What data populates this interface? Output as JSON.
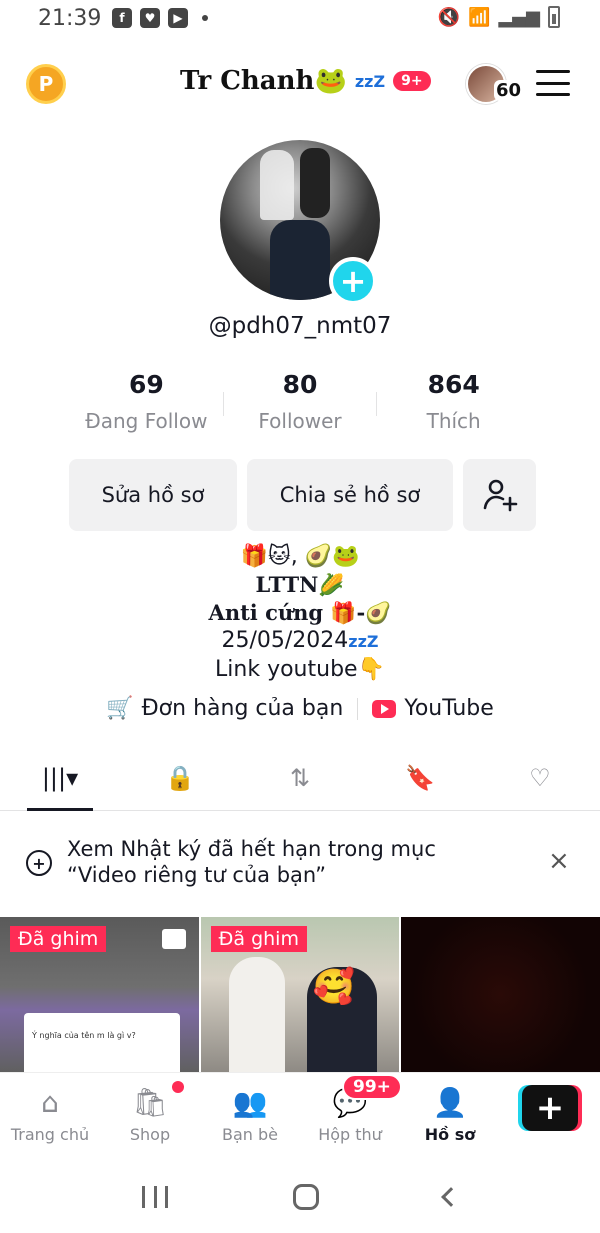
{
  "status_bar": {
    "time": "21:39",
    "left_icons": [
      "facebook-icon",
      "heart-app-icon",
      "video-app-icon"
    ],
    "right_icons": [
      "mute-icon",
      "wifi-icon",
      "signal-icon",
      "battery-icon"
    ]
  },
  "header": {
    "coin_label": "P",
    "title": "Tr Chanh🐸",
    "title_suffix": "zzZ",
    "notification_badge": "9+",
    "story_count": "60"
  },
  "profile": {
    "username": "@pdh07_nmt07",
    "add_icon": "+"
  },
  "stats": [
    {
      "value": "69",
      "label": "Đang Follow"
    },
    {
      "value": "80",
      "label": "Follower"
    },
    {
      "value": "864",
      "label": "Thích"
    }
  ],
  "buttons": {
    "edit": "Sửa hồ sơ",
    "share": "Chia sẻ hồ sơ",
    "add_friend_icon": "add-person-icon"
  },
  "bio": {
    "line1": "🎁🐱, 🥑🐸",
    "line2": "LTTN🌽",
    "line3": "Anti cứng 🎁-🥑",
    "line4": "25/05/2024",
    "line4_suffix": "zzZ",
    "line5": "Link youtube👇"
  },
  "links": {
    "orders": "Đơn hàng của bạn",
    "youtube": "YouTube"
  },
  "tabs": [
    {
      "icon": "grid-icon",
      "label": "|||▾"
    },
    {
      "icon": "lock-icon",
      "label": "🔒"
    },
    {
      "icon": "repost-icon",
      "label": "⇅"
    },
    {
      "icon": "saved-icon",
      "label": "🔖"
    },
    {
      "icon": "liked-icon",
      "label": "♡"
    }
  ],
  "notice": {
    "text": "Xem Nhật ký đã hết hạn trong mục “Video riêng tư của bạn”",
    "close": "×"
  },
  "videos": [
    {
      "pinned_label": "Đã ghim",
      "chat_text": "Ý nghĩa của tên m là gì v?"
    },
    {
      "pinned_label": "Đã ghim"
    },
    {}
  ],
  "bottom_nav": [
    {
      "label": "Trang chủ",
      "icon": "home-icon",
      "glyph": "⌂"
    },
    {
      "label": "Shop",
      "icon": "shop-icon",
      "glyph": "🛍"
    },
    {
      "label": "Bạn bè",
      "icon": "friends-icon",
      "glyph": "👥"
    },
    {
      "label": "Hộp thư",
      "icon": "inbox-icon",
      "glyph": "💬"
    },
    {
      "label": "Hồ sơ",
      "icon": "profile-icon",
      "glyph": "👤"
    }
  ],
  "inbox_badge": "99+",
  "create_label": "+",
  "colors": {
    "accent": "#fe2c55",
    "cyan": "#20d5ec",
    "text": "#161823",
    "muted": "#8a8b91"
  }
}
